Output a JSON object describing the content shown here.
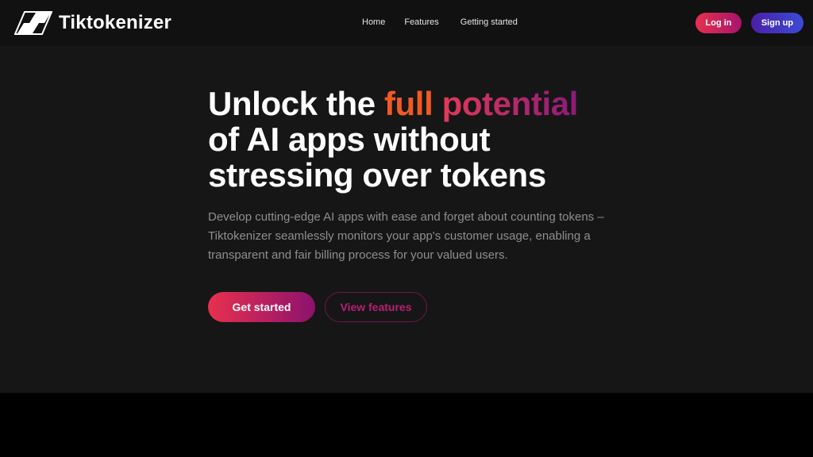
{
  "header": {
    "brand_name": "Tiktokenizer",
    "nav": [
      {
        "label": "Home"
      },
      {
        "label": "Features"
      },
      {
        "label": "Getting started"
      }
    ],
    "login_label": "Log in",
    "signup_label": "Sign up"
  },
  "hero": {
    "headline_part1": "Unlock the ",
    "headline_highlight1": "full",
    "headline_space": " ",
    "headline_highlight2": "potential",
    "headline_line2": "of AI apps without",
    "headline_line3": "stressing over tokens",
    "subtitle": "Develop cutting-edge AI apps with ease and forget about counting tokens – Tiktokenizer seamlessly monitors your app's customer usage, enabling a transparent and fair billing process for your valued users.",
    "primary_cta": "Get started",
    "secondary_cta": "View features"
  },
  "colors": {
    "accent_orange": "#ef5a24",
    "accent_pink": "#e23a5a",
    "accent_purple": "#8a1a7a",
    "signup_blue": "#3b4bd6"
  },
  "icons": {
    "logo": "tiktokenizer-logo-icon"
  }
}
